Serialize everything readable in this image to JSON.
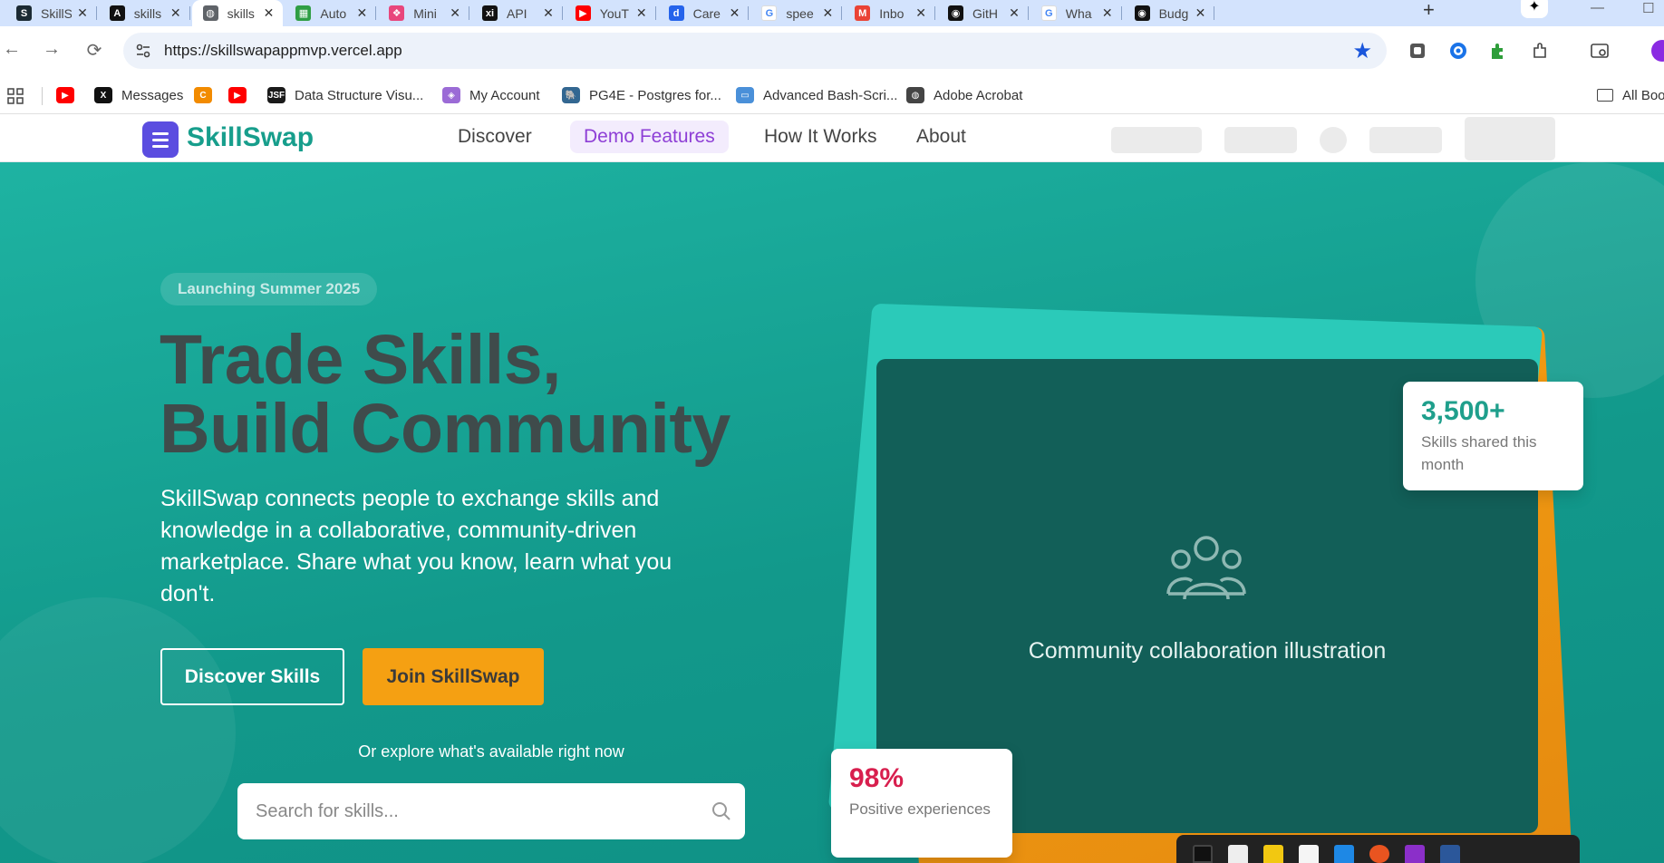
{
  "browser": {
    "tabs": [
      {
        "title": "SkillS",
        "fav_color": "#1b2a33",
        "fav_text": "S"
      },
      {
        "title": "skills",
        "fav_color": "#111111",
        "fav_text": "A"
      },
      {
        "title": "skills",
        "fav_color": "#5f6368",
        "fav_text": "◍",
        "active": true
      },
      {
        "title": "Auto",
        "fav_color": "#2f9e44",
        "fav_text": "▦"
      },
      {
        "title": "Mini",
        "fav_color": "#e8467c",
        "fav_text": "❖"
      },
      {
        "title": "API",
        "fav_color": "#111111",
        "fav_text": "xi"
      },
      {
        "title": "YouT",
        "fav_color": "#ff0000",
        "fav_text": "▶"
      },
      {
        "title": "Care",
        "fav_color": "#2563eb",
        "fav_text": "d"
      },
      {
        "title": "spee",
        "fav_color": "#ffffff",
        "fav_text": "G"
      },
      {
        "title": "Inbo",
        "fav_color": "#ea4335",
        "fav_text": "M"
      },
      {
        "title": "GitH",
        "fav_color": "#111111",
        "fav_text": "◉"
      },
      {
        "title": "Wha",
        "fav_color": "#ffffff",
        "fav_text": "G"
      },
      {
        "title": "Budg",
        "fav_color": "#111111",
        "fav_text": "◉"
      }
    ],
    "close_glyph": "✕",
    "new_tab_glyph": "+",
    "url": "https://skillswapappmvp.vercel.app",
    "bookmarks": [
      {
        "label": "",
        "icon_color": "#ff0000",
        "icon_text": "▶"
      },
      {
        "label": "Messages",
        "icon_color": "#111111",
        "icon_text": "X"
      },
      {
        "label": "",
        "icon_color": "#f28b00",
        "icon_text": "C"
      },
      {
        "label": "",
        "icon_color": "#ff0000",
        "icon_text": "▶"
      },
      {
        "label": "Data Structure Visu...",
        "icon_color": "#1a1a1a",
        "icon_text": "JSF"
      },
      {
        "label": "My Account",
        "icon_color": "#9b6bd6",
        "icon_text": "◈"
      },
      {
        "label": "PG4E - Postgres for...",
        "icon_color": "#336791",
        "icon_text": "🐘"
      },
      {
        "label": "Advanced Bash-Scri...",
        "icon_color": "#4a90d9",
        "icon_text": "▭"
      },
      {
        "label": "Adobe Acrobat",
        "icon_color": "#444444",
        "icon_text": "◍"
      }
    ],
    "all_bookmarks_label": "All Boo"
  },
  "site": {
    "logo_text": "SkillSwap",
    "nav": {
      "discover": "Discover",
      "demo": "Demo Features",
      "how": "How It Works",
      "about": "About"
    }
  },
  "hero": {
    "badge": "Launching Summer 2025",
    "headline_line1": "Trade Skills,",
    "headline_line2": "Build Community",
    "lead": "SkillSwap connects people to exchange skills and knowledge in a collaborative, community-driven marketplace. Share what you know, learn what you don't.",
    "btn_discover": "Discover Skills",
    "btn_join": "Join SkillSwap",
    "explore_text": "Or explore what's available right now",
    "search_placeholder": "Search for skills...",
    "illustration_caption": "Community collaboration illustration",
    "stat_skills_value": "3,500+",
    "stat_skills_label": "Skills shared this month",
    "stat_positive_value": "98%",
    "stat_positive_label": "Positive experiences"
  },
  "colors": {
    "brand_teal": "#179e8c",
    "brand_purple": "#5b4de0",
    "accent_orange": "#f5a012",
    "stat_red": "#d81f4e"
  }
}
